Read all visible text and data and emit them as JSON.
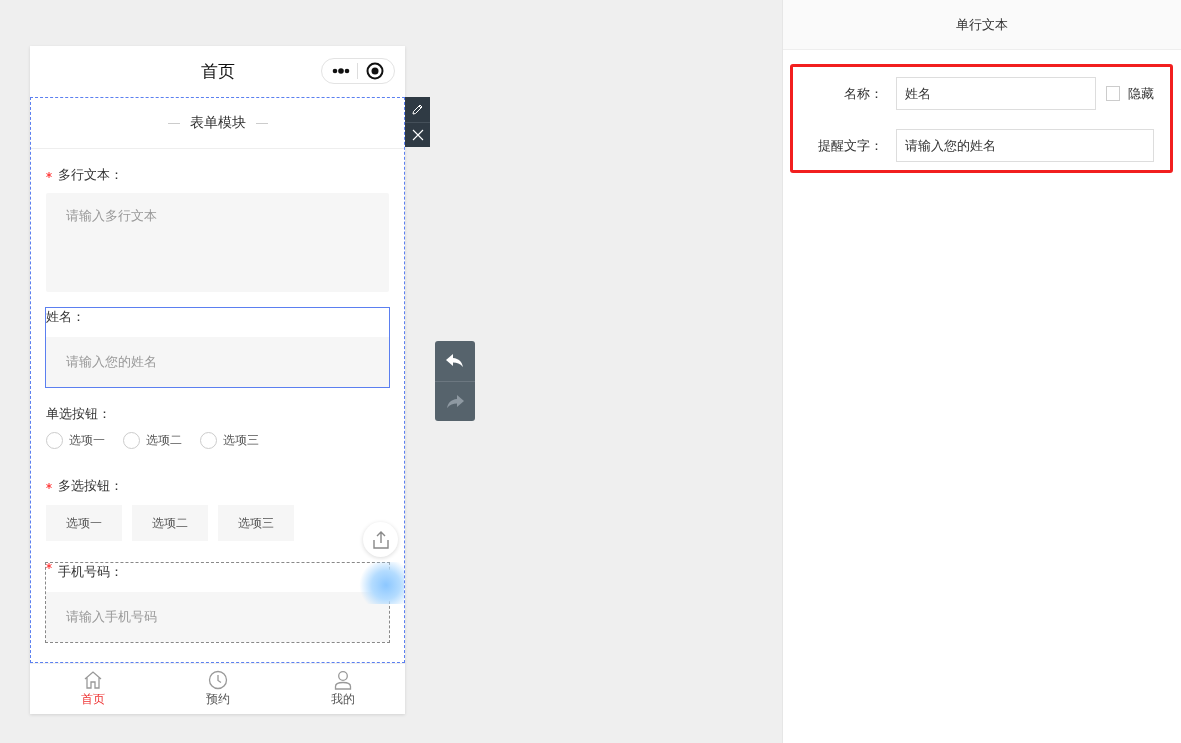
{
  "page_title": "首页",
  "section_title": "表单模块",
  "fields": [
    {
      "kind": "textarea",
      "label": "多行文本：",
      "required": true,
      "placeholder": "请输入多行文本",
      "selected": false,
      "hovered": false
    },
    {
      "kind": "input",
      "label": "姓名：",
      "required": false,
      "placeholder": "请输入您的姓名",
      "selected": true,
      "hovered": false
    },
    {
      "kind": "radio",
      "label": "单选按钮：",
      "required": false,
      "selected": false,
      "hovered": false,
      "options": [
        {
          "label": "选项一",
          "selected": false
        },
        {
          "label": "选项二",
          "selected": false
        },
        {
          "label": "选项三",
          "selected": false
        }
      ]
    },
    {
      "kind": "checkbox",
      "label": "多选按钮：",
      "required": true,
      "selected": false,
      "hovered": false,
      "options": [
        {
          "label": "选项一",
          "selected": false
        },
        {
          "label": "选项二",
          "selected": false
        },
        {
          "label": "选项三",
          "selected": false
        }
      ]
    },
    {
      "kind": "input",
      "label": "手机号码：",
      "required": true,
      "placeholder": "请输入手机号码",
      "selected": false,
      "hovered": true
    }
  ],
  "tabs": [
    {
      "label": "首页",
      "selected": true
    },
    {
      "label": "预约",
      "selected": false
    },
    {
      "label": "我的",
      "selected": false
    }
  ],
  "panel": {
    "title": "单行文本",
    "name_label": "名称：",
    "name_value": "姓名",
    "hidden_label": "隐藏",
    "hidden": false,
    "hint_label": "提醒文字：",
    "hint_value": "请输入您的姓名"
  }
}
